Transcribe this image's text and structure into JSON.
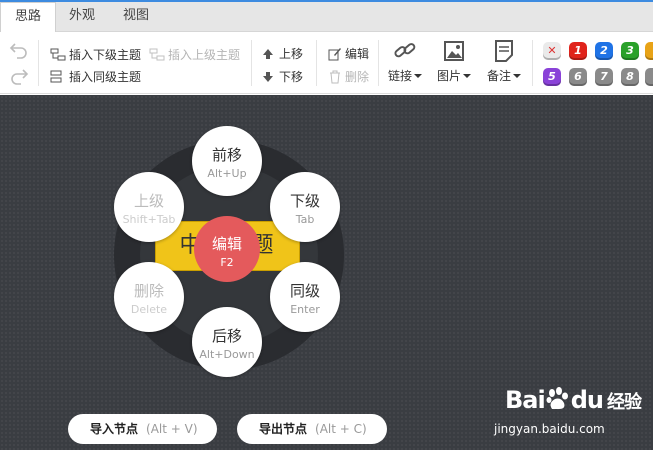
{
  "tabs": [
    {
      "label": "思路",
      "active": true
    },
    {
      "label": "外观",
      "active": false
    },
    {
      "label": "视图",
      "active": false
    }
  ],
  "toolbar": {
    "insert_child": "插入下级主题",
    "insert_parent": "插入上级主题",
    "insert_sibling": "插入同级主题",
    "move_up": "上移",
    "move_down": "下移",
    "edit": "编辑",
    "delete": "删除",
    "link": "链接",
    "image": "图片",
    "note": "备注",
    "priorities": [
      {
        "label": "",
        "color": "#e8e8e8",
        "kind": "clear"
      },
      {
        "label": "1",
        "color": "#e0231b"
      },
      {
        "label": "2",
        "color": "#1f73e6"
      },
      {
        "label": "3",
        "color": "#2aa12a"
      },
      {
        "label": "5",
        "color": "#8a42d8"
      },
      {
        "label": "6",
        "color": "#8a8a8a"
      },
      {
        "label": "7",
        "color": "#8a8a8a"
      },
      {
        "label": "8",
        "color": "#8a8a8a"
      }
    ]
  },
  "canvas": {
    "topic_text": "中心主题",
    "hotbox": {
      "center": {
        "label": "编辑",
        "key": "F2"
      },
      "up": {
        "label": "前移",
        "key": "Alt+Up"
      },
      "parent": {
        "label": "上级",
        "key": "Shift+Tab"
      },
      "child": {
        "label": "下级",
        "key": "Tab"
      },
      "remove": {
        "label": "删除",
        "key": "Delete"
      },
      "sibling": {
        "label": "同级",
        "key": "Enter"
      },
      "down": {
        "label": "后移",
        "key": "Alt+Down"
      }
    },
    "import_label": "导入节点",
    "import_key": "(Alt + V)",
    "export_label": "导出节点",
    "export_key": "(Alt + C)"
  },
  "watermark": {
    "brand": "Bai",
    "brand2": "du",
    "brand_cn": "经验",
    "url": "jingyan.baidu.com"
  },
  "colors": {
    "accent": "#3d8be0",
    "topic": "#f0c419",
    "center_node": "#e45a5c",
    "canvas": "#3a3d42"
  }
}
